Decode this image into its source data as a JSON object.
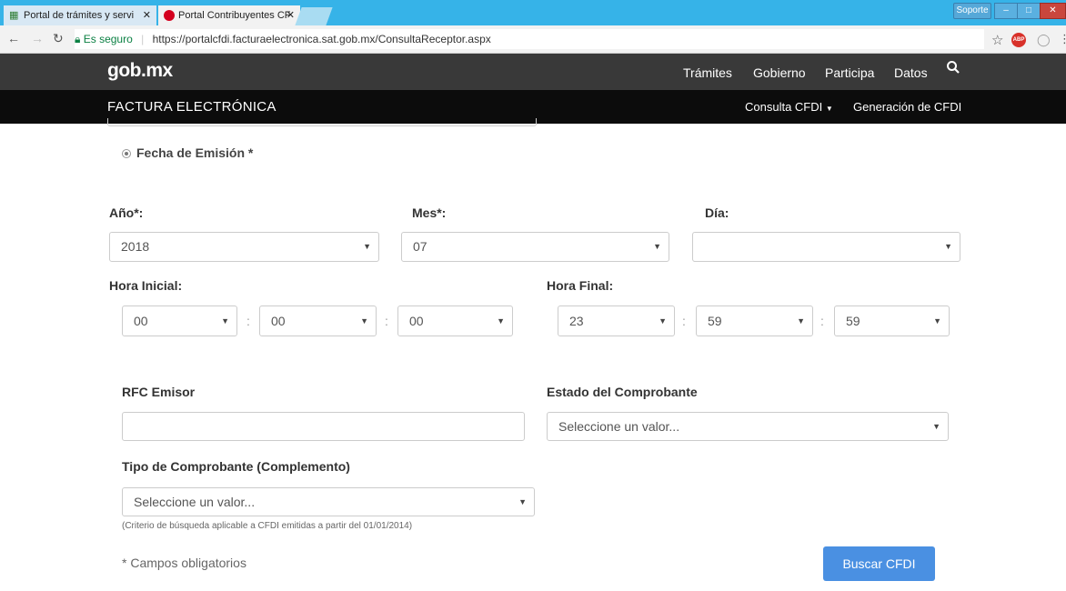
{
  "browser": {
    "tabs": [
      {
        "title": "Portal de trámites y servi"
      },
      {
        "title": "Portal Contribuyentes CF"
      }
    ],
    "soporte": "Soporte",
    "win_min": "–",
    "win_max": "□",
    "win_close": "✕",
    "secure_label": "Es seguro",
    "url": "https://portalcfdi.facturaelectronica.sat.gob.mx/ConsultaReceptor.aspx",
    "abp": "ABP"
  },
  "gov_header": {
    "logo": "gob.mx",
    "nav": [
      "Trámites",
      "Gobierno",
      "Participa",
      "Datos"
    ]
  },
  "site_header": {
    "title": "FACTURA ELECTRÓNICA",
    "nav_consulta": "Consulta CFDI",
    "nav_generacion": "Generación de CFDI"
  },
  "form": {
    "fecha_emision_label": "Fecha de Emisión *",
    "anio_label": "Año*:",
    "mes_label": "Mes*:",
    "dia_label": "Día:",
    "anio_value": "2018",
    "mes_value": "07",
    "dia_value": "",
    "hora_inicial_label": "Hora Inicial:",
    "hora_final_label": "Hora Final:",
    "hora_inicial": [
      "00",
      "00",
      "00"
    ],
    "hora_final": [
      "23",
      "59",
      "59"
    ],
    "rfc_emisor_label": "RFC Emisor",
    "rfc_emisor_value": "",
    "estado_label": "Estado del Comprobante",
    "estado_placeholder": "Seleccione un valor...",
    "tipo_label": "Tipo de Comprobante (Complemento)",
    "tipo_placeholder": "Seleccione un valor...",
    "tipo_note": "(Criterio de búsqueda aplicable a CFDI emitidas a partir del 01/01/2014)",
    "required_note": "* Campos obligatorios",
    "submit_label": "Buscar CFDI"
  }
}
